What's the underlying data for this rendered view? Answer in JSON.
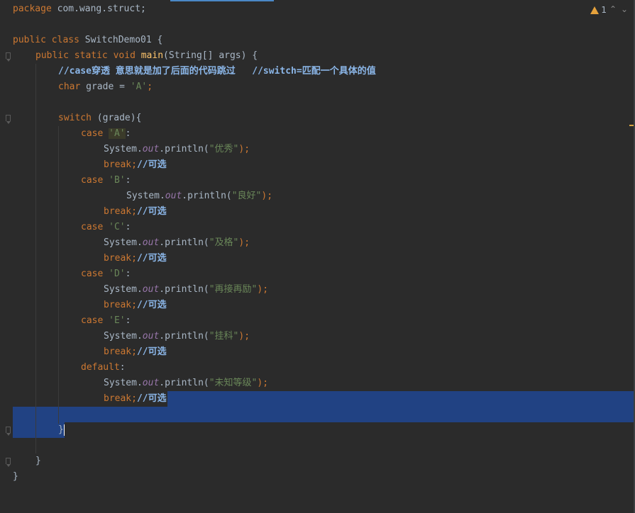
{
  "editor": {
    "warnings_count": "1",
    "lines": {
      "l1": [
        "package",
        "com.wang.struct;"
      ],
      "l3": [
        "public",
        "class",
        "SwitchDemo01 {"
      ],
      "l4": [
        "public",
        "static",
        "void",
        "main",
        "(String[] args) {"
      ],
      "l5": "//case穿透 意思就是加了后面的代码跳过   //switch=匹配一个具体的值",
      "l6": [
        "char",
        " grade = ",
        "'A'",
        ";"
      ],
      "l8": [
        "switch",
        " (grade){"
      ],
      "case_kw": "case",
      "break_kw": "break",
      "default_kw": "default",
      "comment_optional": "//可选",
      "system": "System.",
      "out": "out",
      "println": ".println(",
      "close_call": ");",
      "cases": [
        {
          "label": "'A'",
          "text": "\"优秀\""
        },
        {
          "label": "'B'",
          "text": "\"良好\""
        },
        {
          "label": "'C'",
          "text": "\"及格\""
        },
        {
          "label": "'D'",
          "text": "\"再接再励\""
        },
        {
          "label": "'E'",
          "text": "\"挂科\""
        }
      ],
      "default_text": "\"未知等级\"",
      "close_brace": "}"
    }
  }
}
